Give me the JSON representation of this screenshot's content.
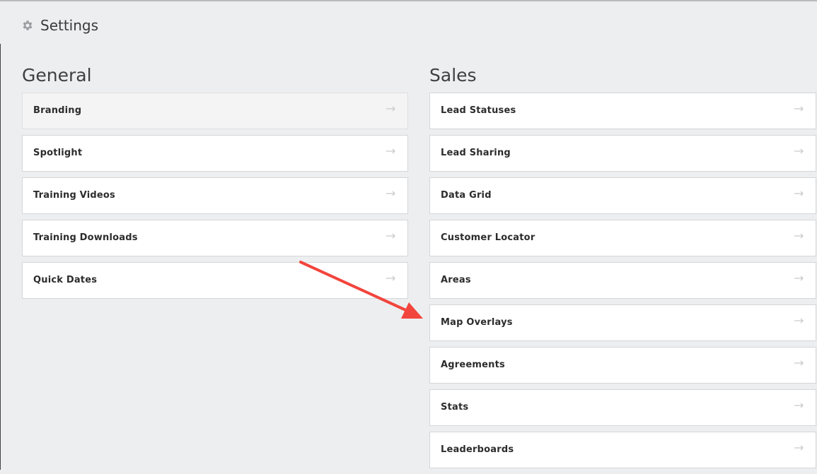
{
  "header": {
    "title": "Settings",
    "icon": "gear-icon"
  },
  "general": {
    "heading": "General",
    "items": [
      {
        "label": "Branding"
      },
      {
        "label": "Spotlight"
      },
      {
        "label": "Training Videos"
      },
      {
        "label": "Training Downloads"
      },
      {
        "label": "Quick Dates"
      }
    ]
  },
  "sales": {
    "heading": "Sales",
    "items": [
      {
        "label": "Lead Statuses"
      },
      {
        "label": "Lead Sharing"
      },
      {
        "label": "Data Grid"
      },
      {
        "label": "Customer Locator"
      },
      {
        "label": "Areas"
      },
      {
        "label": "Map Overlays"
      },
      {
        "label": "Agreements"
      },
      {
        "label": "Stats"
      },
      {
        "label": "Leaderboards"
      }
    ]
  },
  "colors": {
    "background": "#edeef0",
    "card": "#ffffff",
    "card_border": "#d4d6d9",
    "annotation_arrow": "#f2453d",
    "item_arrow": "#c9cbce"
  }
}
